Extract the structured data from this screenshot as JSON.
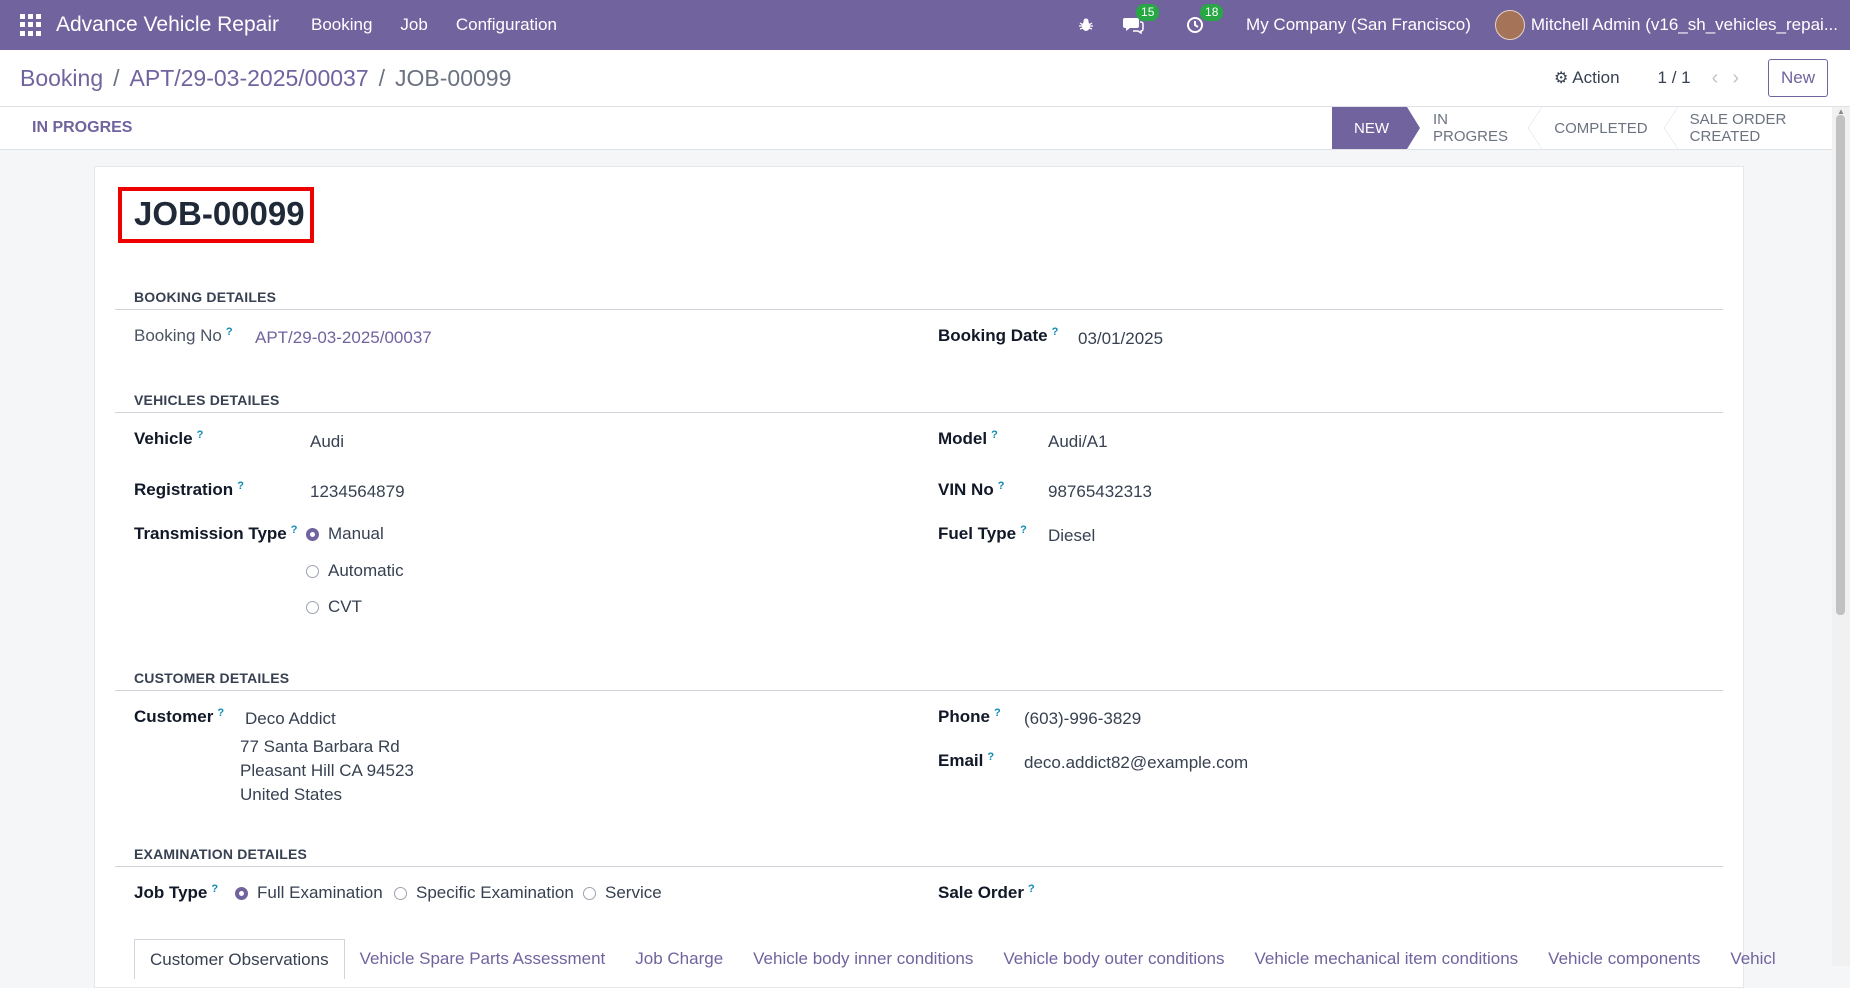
{
  "navbar": {
    "app_name": "Advance Vehicle Repair",
    "menu": [
      "Booking",
      "Job",
      "Configuration"
    ],
    "messages_count": "15",
    "activities_count": "18",
    "company": "My Company (San Francisco)",
    "user": "Mitchell Admin (v16_sh_vehicles_repai..."
  },
  "breadcrumb": {
    "root": "Booking",
    "middle": "APT/29-03-2025/00037",
    "current": "JOB-00099"
  },
  "control": {
    "action_label": "Action",
    "pager": "1 / 1",
    "new_label": "New"
  },
  "statusbar": {
    "button_label": "IN PROGRES",
    "stages": [
      "NEW",
      "IN PROGRES",
      "COMPLETED",
      "SALE ORDER CREATED"
    ],
    "active_stage": "NEW"
  },
  "form": {
    "title": "JOB-00099",
    "booking": {
      "section": "BOOKING DETAILES",
      "booking_no_label": "Booking No",
      "booking_no": "APT/29-03-2025/00037",
      "booking_date_label": "Booking Date",
      "booking_date": "03/01/2025"
    },
    "vehicle": {
      "section": "VEHICLES DETAILES",
      "vehicle_label": "Vehicle",
      "vehicle": "Audi",
      "model_label": "Model",
      "model": "Audi/A1",
      "registration_label": "Registration",
      "registration": "1234564879",
      "vin_label": "VIN No",
      "vin": "98765432313",
      "transmission_label": "Transmission Type",
      "transmission_options": [
        "Manual",
        "Automatic",
        "CVT"
      ],
      "transmission_selected": "Manual",
      "fuel_label": "Fuel Type",
      "fuel": "Diesel"
    },
    "customer": {
      "section": "CUSTOMER DETAILES",
      "customer_label": "Customer",
      "name": "Deco Addict",
      "address_line1": "77 Santa Barbara Rd",
      "address_line2": "Pleasant Hill CA 94523",
      "address_line3": "United States",
      "phone_label": "Phone",
      "phone": "(603)-996-3829",
      "email_label": "Email",
      "email": "deco.addict82@example.com"
    },
    "examination": {
      "section": "EXAMINATION DETAILES",
      "job_type_label": "Job Type",
      "job_types": [
        "Full Examination",
        "Specific Examination",
        "Service"
      ],
      "job_type_selected": "Full Examination",
      "sale_order_label": "Sale Order"
    },
    "tabs": [
      "Customer Observations",
      "Vehicle Spare Parts Assessment",
      "Job Charge",
      "Vehicle body inner conditions",
      "Vehicle body outer conditions",
      "Vehicle mechanical item conditions",
      "Vehicle components",
      "Vehicl"
    ],
    "active_tab": "Customer Observations"
  },
  "help_marker": "?",
  "colors": {
    "brand": "#71639e",
    "badge": "#28a745",
    "highlight_border": "#ee0000"
  }
}
